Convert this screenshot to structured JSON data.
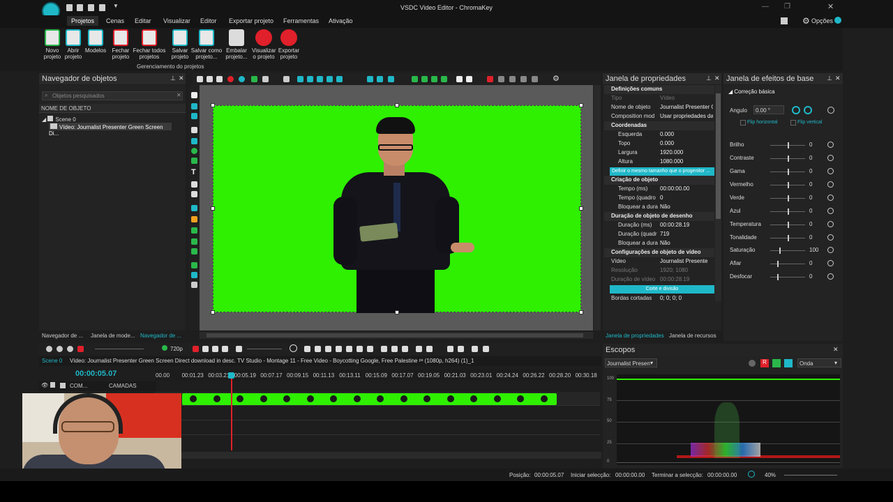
{
  "window": {
    "title": "VSDC Video Editor - ChromaKey",
    "options_label": "Opções"
  },
  "menu": [
    "Projetos",
    "Cenas",
    "Editar",
    "Visualizar",
    "Editor",
    "Exportar projeto",
    "Ferramentas",
    "Ativação"
  ],
  "ribbon": {
    "buttons": [
      {
        "l1": "Novo",
        "l2": "projeto"
      },
      {
        "l1": "Abrir",
        "l2": "projeto"
      },
      {
        "l1": "Modelos",
        "l2": ""
      },
      {
        "l1": "Fechar",
        "l2": "projeto"
      },
      {
        "l1": "Fechar todos",
        "l2": "projetos"
      },
      {
        "l1": "Salvar",
        "l2": "projeto"
      },
      {
        "l1": "Salvar como",
        "l2": "projeto..."
      },
      {
        "l1": "Embalar",
        "l2": "projeto..."
      },
      {
        "l1": "Visualizar",
        "l2": "o projeto"
      },
      {
        "l1": "Exportar",
        "l2": "projeto"
      }
    ],
    "group_label": "Gerenciamento do projetos"
  },
  "object_nav": {
    "title": "Navegador de objetos",
    "search_placeholder": "Objetos pesquisados",
    "col_header": "NOME DE OBJETO",
    "scene": "Scene 0",
    "video": "Vídeo: Journalist Presenter Green Screen Di...",
    "tabs": [
      "Navegador de ...",
      "Janela de mode...",
      "Navegador de ..."
    ]
  },
  "properties": {
    "title": "Janela de propriedades",
    "sec_common": "Definições comuns",
    "rows_common": [
      {
        "k": "Tipo",
        "v": "Vídeo"
      },
      {
        "k": "Nome de objeto",
        "v": "Journalist Presenter G"
      },
      {
        "k": "Composition mod",
        "v": "Usar propriedades da"
      }
    ],
    "sec_coords": "Coordenadas",
    "rows_coords": [
      {
        "k": "Esquerda",
        "v": "0.000"
      },
      {
        "k": "Topo",
        "v": "0.000"
      },
      {
        "k": "Largura",
        "v": "1920.000"
      },
      {
        "k": "Altura",
        "v": "1080.000"
      }
    ],
    "same_size_btn": "Definir o mesmo tamanho que o  progenitor ...",
    "sec_creation": "Criação de objeto",
    "rows_creation": [
      {
        "k": "Tempo (ms)",
        "v": "00:00:00.00"
      },
      {
        "k": "Tempo (quadro",
        "v": "0"
      },
      {
        "k": "Bloquear a dura",
        "v": "Não"
      }
    ],
    "sec_duration": "Duração de objeto de desenho",
    "rows_duration": [
      {
        "k": "Duração (ms)",
        "v": "00:00:28.19"
      },
      {
        "k": "Duração (quadr",
        "v": "719"
      },
      {
        "k": "Bloquear a dura",
        "v": "Não"
      }
    ],
    "sec_video": "Configurações de objeto de vídeo",
    "rows_video": [
      {
        "k": "Vídeo",
        "v": "Journalist Presente"
      },
      {
        "k": "Resolução",
        "v": "1920; 1080"
      },
      {
        "k": "Duração de vídeo",
        "v": "00:00:28.19"
      }
    ],
    "cut_btn": "Corte e divisão",
    "rows_border": [
      {
        "k": "Bordas cortadas",
        "v": "0; 0; 0; 0"
      }
    ],
    "tabs": [
      "Janela de propriedades",
      "Janela de recursos"
    ]
  },
  "effects": {
    "title": "Janela de efeitos de base",
    "section": "Correção básica",
    "angle_label": "Angulo",
    "angle_value": "0.00 °",
    "flip_h": "Flip horizontal",
    "flip_v": "Flip vertical",
    "rows": [
      {
        "k": "Brilho",
        "v": "0",
        "pos": 0.5
      },
      {
        "k": "Contraste",
        "v": "0",
        "pos": 0.5
      },
      {
        "k": "Gama",
        "v": "0",
        "pos": 0.5
      },
      {
        "k": "Vermelho",
        "v": "0",
        "pos": 0.5
      },
      {
        "k": "Verde",
        "v": "0",
        "pos": 0.5
      },
      {
        "k": "Azul",
        "v": "0",
        "pos": 0.5
      },
      {
        "k": "Temperatura",
        "v": "0",
        "pos": 0.5
      },
      {
        "k": "Tonalidade",
        "v": "0",
        "pos": 0.5
      },
      {
        "k": "Saturação",
        "v": "100",
        "pos": 0.25
      },
      {
        "k": "Afiar",
        "v": "0",
        "pos": 0.2
      },
      {
        "k": "Desfocar",
        "v": "0",
        "pos": 0.2
      }
    ]
  },
  "timeline": {
    "resolution": "720p",
    "scene_tab": "Scene 0",
    "clip_path": "Vídeo: Journalist Presenter Green Screen Direct download in desc. TV Studio - Montage 11 - Free Video - Boycotting Google, Free Palestine ᵖˢ (1080p, h264) (1)_1",
    "time": "00:00:05.07",
    "layer_label": "COM...",
    "layers_label": "CAMADAS",
    "ticks": [
      "00.00",
      "00:01.23",
      "00:03.21",
      "00:05.19",
      "00:07.17",
      "00:09.15",
      "00:11.13",
      "00:13.11",
      "00:15.09",
      "00:17.07",
      "00:19.05",
      "00:21.03",
      "00:23.01",
      "00:24.24",
      "00:26.22",
      "00:28.20",
      "00:30.18"
    ]
  },
  "scopes": {
    "title": "Escopos",
    "source": "Journalist Presen",
    "mode": "Onda",
    "levels": [
      "100",
      "75",
      "50",
      "25",
      "0"
    ]
  },
  "status": {
    "position_label": "Posição:",
    "position": "00:00:05.07",
    "sel_start_label": "Iniciar selecção:",
    "sel_start": "00:00:00.00",
    "sel_end_label": "Terminar a selecção:",
    "sel_end": "00:00:00.00",
    "zoom": "40%"
  },
  "colors": {
    "accent": "#1fb8c8",
    "chroma": "#2ef000",
    "record": "#e0202a"
  }
}
